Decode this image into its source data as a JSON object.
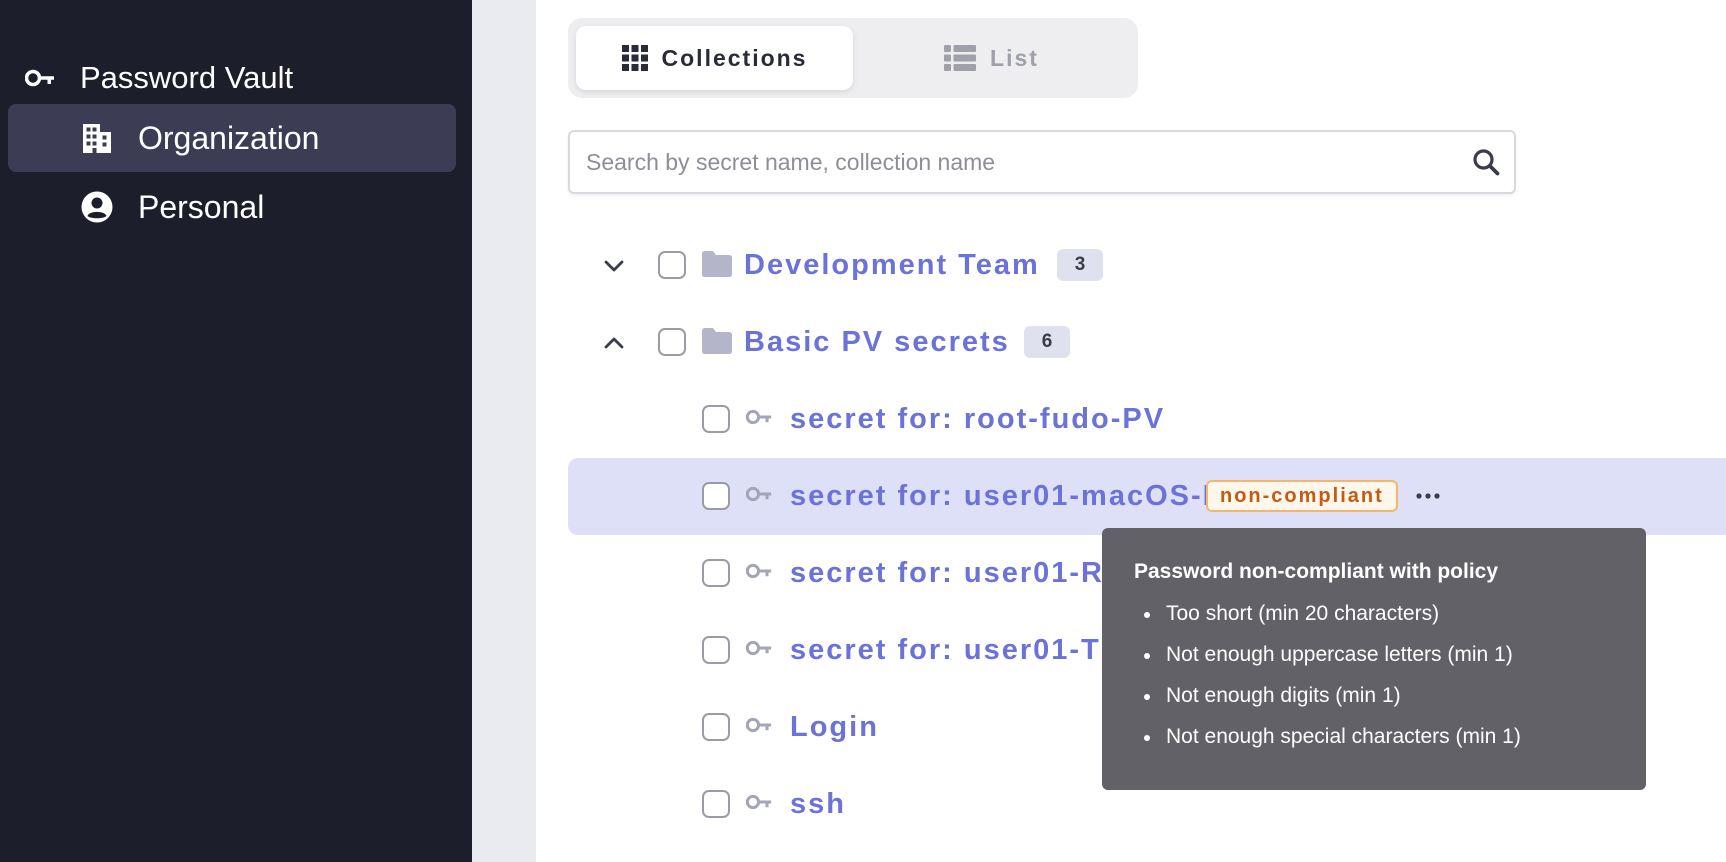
{
  "sidebar": {
    "title": "Password Vault",
    "items": [
      {
        "label": "Organization",
        "active": true,
        "icon": "building-icon"
      },
      {
        "label": "Personal",
        "active": false,
        "icon": "user-circle-icon"
      }
    ]
  },
  "view_toggle": {
    "collections_label": "Collections",
    "list_label": "List",
    "active": "collections"
  },
  "search": {
    "placeholder": "Search by secret name, collection name"
  },
  "tree": {
    "collections": [
      {
        "name": "Development Team",
        "count": "3",
        "expanded": false
      },
      {
        "name": "Basic PV secrets",
        "count": "6",
        "expanded": true
      }
    ],
    "secrets": [
      {
        "name": "secret for: root-fudo-PV"
      },
      {
        "name": "secret for: user01-macOS-PV",
        "badge": "non-compliant",
        "highlighted": true
      },
      {
        "name": "secret for: user01-R"
      },
      {
        "name": "secret for: user01-T"
      },
      {
        "name": "Login"
      },
      {
        "name": "ssh"
      }
    ]
  },
  "tooltip": {
    "title": "Password non-compliant with policy",
    "items": [
      "Too short (min 20 characters)",
      "Not enough uppercase letters (min 1)",
      "Not enough digits (min 1)",
      "Not enough special characters (min 1)"
    ]
  },
  "colors": {
    "sidebar_bg": "#1d1e2c",
    "sidebar_active": "#3c3d55",
    "link": "#6b72d8",
    "row_highlight": "#dee0f7",
    "warning": "#c45a14",
    "tooltip_bg": "#636168"
  }
}
